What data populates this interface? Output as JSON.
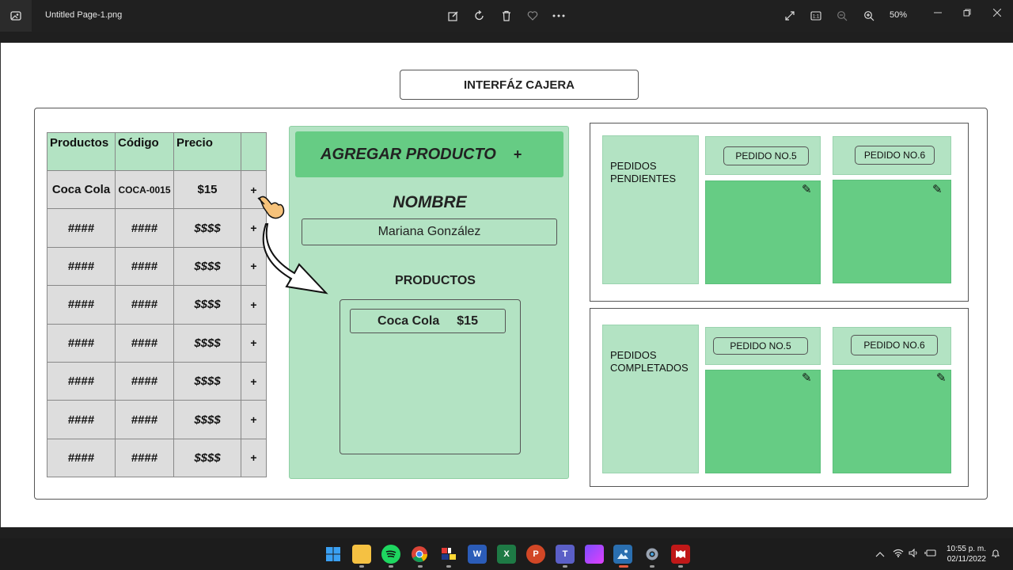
{
  "window": {
    "file_name": "Untitled Page-1.png",
    "zoom": "50%",
    "toolbar_icons": [
      "edit-image-icon",
      "rotate-icon",
      "delete-icon",
      "favorite-icon",
      "more-icon"
    ],
    "view_icons": [
      "fullscreen-icon",
      "actual-size-icon",
      "zoom-out-icon",
      "zoom-in-icon"
    ]
  },
  "mockup": {
    "header": "INTERFÁZ CAJERA",
    "table": {
      "columns": [
        "Productos",
        "Código",
        "Precio",
        ""
      ],
      "rows": [
        {
          "product": "Coca Cola",
          "code": "COCA-0015",
          "price": "$15",
          "action": "+"
        },
        {
          "product": "####",
          "code": "####",
          "price": "$$$$",
          "action": "+"
        },
        {
          "product": "####",
          "code": "####",
          "price": "$$$$",
          "action": "+"
        },
        {
          "product": "####",
          "code": "####",
          "price": "$$$$",
          "action": "+"
        },
        {
          "product": "####",
          "code": "####",
          "price": "$$$$",
          "action": "+"
        },
        {
          "product": "####",
          "code": "####",
          "price": "$$$$",
          "action": "+"
        },
        {
          "product": "####",
          "code": "####",
          "price": "$$$$",
          "action": "+"
        },
        {
          "product": "####",
          "code": "####",
          "price": "$$$$",
          "action": "+"
        }
      ]
    },
    "add_product": {
      "title": "AGREGAR PRODUCTO",
      "plus": "+",
      "name_label": "NOMBRE",
      "name_value": "Mariana González",
      "products_label": "PRODUCTOS",
      "selected_product": {
        "name": "Coca Cola",
        "price": "$15"
      }
    },
    "pending": {
      "label_line1": "PEDIDOS",
      "label_line2": "PENDIENTES",
      "orders": [
        "PEDIDO NO.5",
        "PEDIDO NO.6"
      ]
    },
    "completed": {
      "label_line1": "PEDIDOS",
      "label_line2": "COMPLETADOS",
      "orders": [
        "PEDIDO NO.5",
        "PEDIDO NO.6"
      ]
    },
    "colors": {
      "light_green": "#b3e3c3",
      "green": "#66cc84",
      "gray_cell": "#dddddd"
    }
  },
  "taskbar": {
    "apps": [
      "start-icon",
      "file-explorer-icon",
      "spotify-icon",
      "chrome-icon",
      "paint-app-icon",
      "word-icon",
      "excel-icon",
      "powerpoint-icon",
      "teams-icon",
      "clipchamp-icon",
      "photos-icon",
      "settings-icon",
      "mcafee-icon"
    ],
    "time": "10:55 p. m.",
    "date": "02/11/2022"
  }
}
